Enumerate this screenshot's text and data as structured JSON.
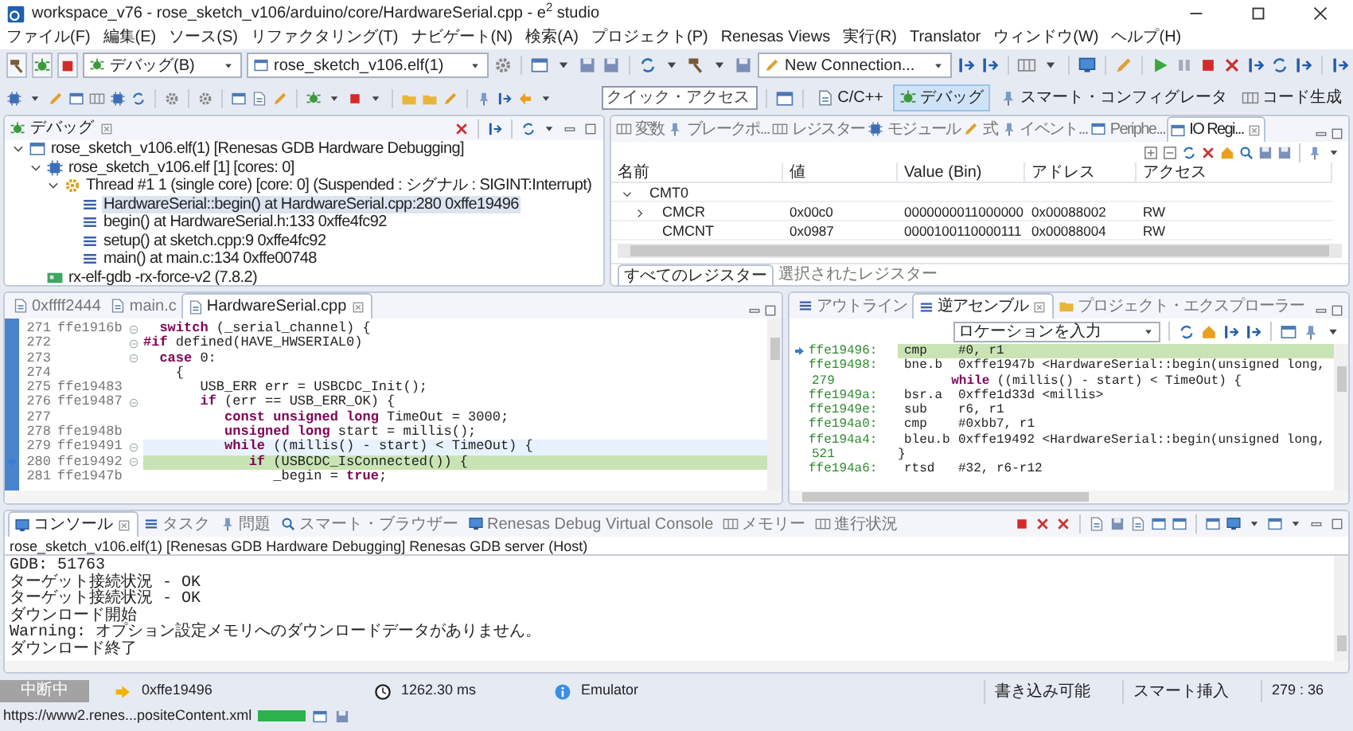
{
  "window": {
    "title": "workspace_v76 - rose_sketch_v106/arduino/core/HardwareSerial.cpp - e$^{2}$ studio"
  },
  "menu": [
    "ファイル(F)",
    "編集(E)",
    "ソース(S)",
    "リファクタリング(T)",
    "ナビゲート(N)",
    "検索(A)",
    "プロジェクト(P)",
    "Renesas Views",
    "実行(R)",
    "Translator",
    "ウィンドウ(W)",
    "ヘルプ(H)"
  ],
  "toolbar": {
    "launch_mode": "デバッグ(B)",
    "launch_config": "rose_sketch_v106.elf(1)",
    "connection": "New Connection..."
  },
  "quick_access": {
    "placeholder": "クイック・アクセス"
  },
  "perspectives": [
    {
      "label": "C/C++",
      "selected": false
    },
    {
      "label": "デバッグ",
      "selected": true
    },
    {
      "label": "スマート・コンフィグレータ",
      "selected": false
    },
    {
      "label": "コード生成",
      "selected": false
    }
  ],
  "debug_view": {
    "title": "デバッグ",
    "tree": [
      {
        "label": "rose_sketch_v106.elf(1) [Renesas GDB Hardware Debugging]",
        "kind": "launch",
        "expanded": true,
        "children": [
          {
            "label": "rose_sketch_v106.elf [1] [cores: 0]",
            "kind": "process",
            "expanded": true,
            "children": [
              {
                "label": "Thread #1 1 (single core) [core: 0] (Suspended : シグナル : SIGINT:Interrupt)",
                "kind": "thread",
                "expanded": true,
                "children": [
                  {
                    "label": "HardwareSerial::begin() at HardwareSerial.cpp:280 0xffe19496",
                    "kind": "frame",
                    "selected": true
                  },
                  {
                    "label": "begin() at HardwareSerial.h:133 0xffe4fc92",
                    "kind": "frame",
                    "selected": false
                  },
                  {
                    "label": "setup() at sketch.cpp:9 0xffe4fc92",
                    "kind": "frame",
                    "selected": false
                  },
                  {
                    "label": "main() at main.c:134 0xffe00748",
                    "kind": "frame",
                    "selected": false
                  }
                ]
              }
            ]
          },
          {
            "label": "rx-elf-gdb -rx-force-v2 (7.8.2)",
            "kind": "gdb"
          }
        ]
      }
    ]
  },
  "register_view": {
    "tabs": [
      {
        "label": "変数",
        "selected": false
      },
      {
        "label": "ブレークポ...",
        "selected": false
      },
      {
        "label": "レジスター",
        "selected": false
      },
      {
        "label": "モジュール",
        "selected": false
      },
      {
        "label": "式",
        "selected": false
      },
      {
        "label": "イベント...",
        "selected": false
      },
      {
        "label": "Periphe...",
        "selected": false
      },
      {
        "label": "IO Regi...",
        "selected": true
      }
    ],
    "columns": [
      "名前",
      "値",
      "Value (Bin)",
      "アドレス",
      "アクセス"
    ],
    "rows": [
      {
        "name": "CMT0",
        "expanded": true,
        "children": [
          {
            "name": "CMCR",
            "expanded": false,
            "value": "0x00c0",
            "value_bin": "0000000011000000",
            "address": "0x00088002",
            "access": "RW"
          },
          {
            "name": "CMCNT",
            "value": "0x0987",
            "value_bin": "0000100110000111",
            "address": "0x00088004",
            "access": "RW"
          }
        ]
      }
    ],
    "bottom_tabs": [
      {
        "label": "すべてのレジスター",
        "selected": true
      },
      {
        "label": "選択されたレジスター",
        "selected": false
      }
    ]
  },
  "editor": {
    "tabs": [
      {
        "label": "0xffff2444",
        "selected": false
      },
      {
        "label": "main.c",
        "selected": false
      },
      {
        "label": "HardwareSerial.cpp",
        "selected": true
      }
    ],
    "lines": [
      {
        "number": "271",
        "address": "ffe1916b",
        "code": "  **switch** (_serial_channel) {",
        "fold_marker": true,
        "current": false,
        "cursor_line": false
      },
      {
        "number": "272",
        "code": "**#if** defined(HAVE_HWSERIAL0)",
        "fold_marker": true,
        "current": false,
        "cursor_line": false
      },
      {
        "number": "273",
        "code": "  **case** 0:",
        "fold_marker": true,
        "current": false,
        "cursor_line": false
      },
      {
        "number": "274",
        "code": "    {",
        "fold_marker": false,
        "current": false,
        "cursor_line": false
      },
      {
        "number": "275",
        "address": "ffe19483",
        "code": "       USB_ERR err = USBCDC_Init();",
        "fold_marker": false,
        "current": false,
        "cursor_line": false
      },
      {
        "number": "276",
        "address": "ffe19487",
        "code": "       **if** (err == USB_ERR_OK) {",
        "fold_marker": true,
        "current": false,
        "cursor_line": false
      },
      {
        "number": "277",
        "code": "          **const unsigned long** TimeOut = 3000;",
        "fold_marker": false,
        "current": false,
        "cursor_line": false
      },
      {
        "number": "278",
        "address": "ffe1948b",
        "code": "          **unsigned long** start = millis();",
        "fold_marker": false,
        "current": false,
        "cursor_line": false
      },
      {
        "number": "279",
        "address": "ffe19491",
        "code": "          **while** ((millis() - start) < TimeOut) {",
        "fold_marker": true,
        "current": false,
        "cursor_line": true
      },
      {
        "number": "280",
        "address": "ffe19492",
        "code": "             **if** (USBCDC_IsConnected()) {",
        "fold_marker": true,
        "current": true,
        "cursor_line": false
      },
      {
        "number": "281",
        "address": "ffe1947b",
        "code": "                _begin = **true**;",
        "fold_marker": false,
        "current": false,
        "cursor_line": false
      }
    ]
  },
  "disassembly": {
    "tabs": [
      {
        "label": "アウトライン",
        "selected": false
      },
      {
        "label": "逆アセンブル",
        "selected": true
      },
      {
        "label": "プロジェクト・エクスプローラー",
        "selected": false
      }
    ],
    "location_placeholder": "ロケーションを入力",
    "lines": [
      {
        "kind": "instruction",
        "address": "ffe19496:",
        "mnemonic": "cmp",
        "operands": "#0, r1",
        "current": true
      },
      {
        "kind": "instruction",
        "address": "ffe19498:",
        "mnemonic": "bne.b",
        "operands": "0xffe1947b <HardwareSerial::begin(unsigned long,",
        "current": false
      },
      {
        "kind": "source",
        "number": "279",
        "text": "       **while** ((millis() - start) < TimeOut) {"
      },
      {
        "kind": "instruction",
        "address": "ffe1949a:",
        "mnemonic": "bsr.a",
        "operands": "0xffe1d33d <millis>",
        "current": false
      },
      {
        "kind": "instruction",
        "address": "ffe1949e:",
        "mnemonic": "sub",
        "operands": "r6, r1",
        "current": false
      },
      {
        "kind": "instruction",
        "address": "ffe194a0:",
        "mnemonic": "cmp",
        "operands": "#0xbb7, r1",
        "current": false
      },
      {
        "kind": "instruction",
        "address": "ffe194a4:",
        "mnemonic": "bleu.b",
        "operands": "0xffe19492 <HardwareSerial::begin(unsigned long,",
        "current": false
      },
      {
        "kind": "source",
        "number": "521",
        "text": "}"
      },
      {
        "kind": "instruction",
        "address": "ffe194a6:",
        "mnemonic": "rtsd",
        "operands": "#32, r6-r12",
        "current": false
      }
    ]
  },
  "console": {
    "tabs": [
      {
        "label": "コンソール",
        "selected": true
      },
      {
        "label": "タスク",
        "selected": false
      },
      {
        "label": "問題",
        "selected": false
      },
      {
        "label": "スマート・ブラウザー",
        "selected": false
      },
      {
        "label": "Renesas Debug Virtual Console",
        "selected": false
      },
      {
        "label": "メモリー",
        "selected": false
      },
      {
        "label": "進行状況",
        "selected": false
      }
    ],
    "header": "rose_sketch_v106.elf(1) [Renesas GDB Hardware Debugging] Renesas GDB server (Host)",
    "lines": [
      "GDB: 51763",
      "ターゲット接続状況 - OK",
      "ターゲット接続状況 - OK",
      "ダウンロード開始",
      "Warning: オプション設定メモリへのダウンロードデータがありません。",
      "ダウンロード終了"
    ]
  },
  "status_bar": {
    "state": "中断中",
    "pc": "0xffe19496",
    "elapsed": "1262.30 ms",
    "target": "Emulator",
    "write_mode": "書き込み可能",
    "insert_mode": "スマート挿入",
    "position": "279 : 36"
  },
  "progress": {
    "url": "https://www2.renes...positeContent.xml",
    "level": 1
  }
}
